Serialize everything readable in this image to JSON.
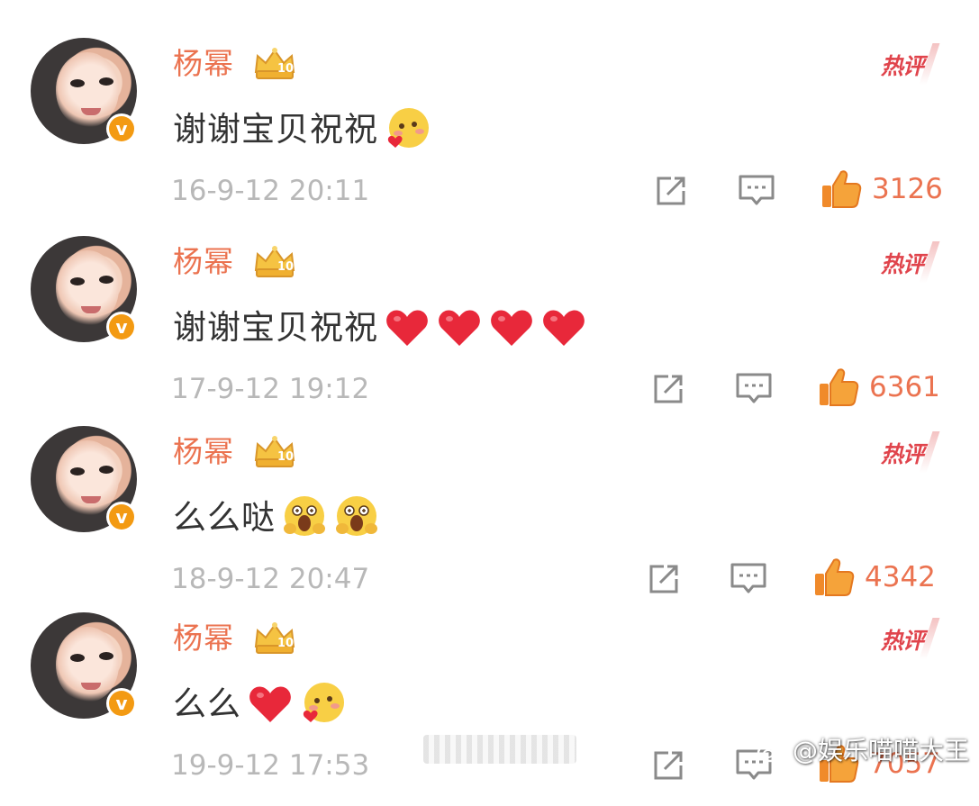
{
  "comments": [
    {
      "username": "杨幂",
      "badge": "crown-vip-icon",
      "hot_label": "热评",
      "text": "谢谢宝贝祝祝",
      "emojis": [
        "blush-heart-emoji"
      ],
      "time": "16-9-12 20:11",
      "likes": "3126"
    },
    {
      "username": "杨幂",
      "badge": "crown-vip-icon",
      "hot_label": "热评",
      "text": "谢谢宝贝祝祝",
      "emojis": [
        "red-heart-emoji",
        "red-heart-emoji",
        "red-heart-emoji",
        "red-heart-emoji"
      ],
      "time": "17-9-12 19:12",
      "likes": "6361"
    },
    {
      "username": "杨幂",
      "badge": "crown-vip-icon",
      "hot_label": "热评",
      "text": "么么哒",
      "emojis": [
        "hug-emoji",
        "hug-emoji"
      ],
      "time": "18-9-12 20:47",
      "likes": "4342"
    },
    {
      "username": "杨幂",
      "badge": "crown-vip-icon",
      "hot_label": "热评",
      "text": "么么",
      "emojis": [
        "red-heart-emoji",
        "blush-heart-emoji"
      ],
      "time": "19-9-12 17:53",
      "likes": "7057"
    }
  ],
  "watermark": {
    "logo": "weibo-logo-icon",
    "text": "@娱乐喵喵大王"
  },
  "colors": {
    "username": "#eb7350",
    "hot": "#e0444c",
    "timestamp": "#b8b8b8",
    "like_count": "#eb7350",
    "text": "#333333",
    "verified_badge": "#f39a12"
  }
}
